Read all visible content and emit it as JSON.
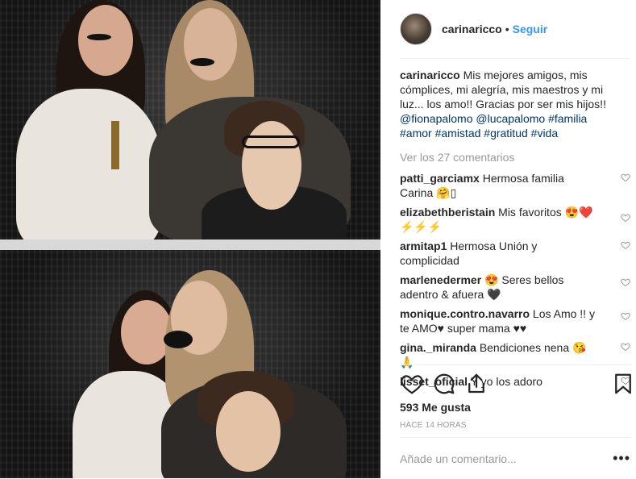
{
  "post": {
    "username": "carinaricco",
    "follow_label": "Seguir",
    "separator": "•"
  },
  "caption": {
    "username": "carinaricco",
    "text": "Mis mejores amigos, mis cómplices, mi alegría, mis maestros y mi luz... los amo!! Gracias por ser mis hijos!!",
    "mentions": [
      "@fionapalomo",
      "@lucapalomo"
    ],
    "hashtags": [
      "#familia",
      "#amor",
      "#amistad",
      "#gratitud",
      "#vida"
    ]
  },
  "view_all": "Ver los 27 comentarios",
  "comments": [
    {
      "user": "patti_garciamx",
      "text": "Hermosa familia Carina 🤗▯"
    },
    {
      "user": "elizabethberistain",
      "text": "Mis favoritos 😍❤️⚡⚡⚡"
    },
    {
      "user": "armitap1",
      "text": "Hermosa Unión y complicidad"
    },
    {
      "user": "marlenedermer",
      "text": "😍 Seres bellos adentro & afuera 🖤"
    },
    {
      "user": "monique.contro.navarro",
      "text": "Los Amo !! y te AMO♥ super mama ♥♥"
    },
    {
      "user": "gina._miranda",
      "text": "Bendiciones nena 😘🙏"
    },
    {
      "user": "lisset_oficial",
      "text": "Y yo los adoro"
    }
  ],
  "likes": "593 Me gusta",
  "time": "HACE 14 HORAS",
  "add_comment_placeholder": "Añade un comentario...",
  "more_label": "•••",
  "icons": {
    "like": "heart-icon",
    "comment": "comment-icon",
    "share": "share-icon",
    "save": "bookmark-icon"
  }
}
